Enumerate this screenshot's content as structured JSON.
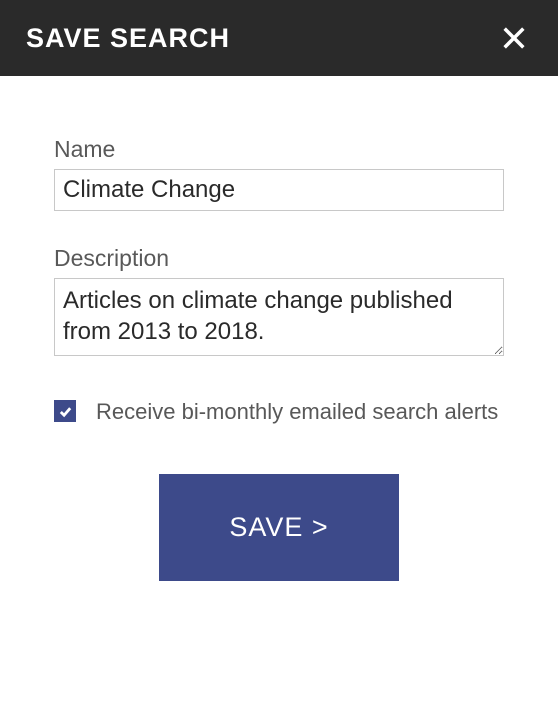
{
  "header": {
    "title": "SAVE SEARCH"
  },
  "form": {
    "name_label": "Name",
    "name_value": "Climate Change",
    "description_label": "Description",
    "description_value": "Articles on climate change published from 2013 to 2018.",
    "alerts_checked": true,
    "alerts_label": "Receive bi-monthly emailed search alerts",
    "save_button_label": "SAVE >"
  }
}
